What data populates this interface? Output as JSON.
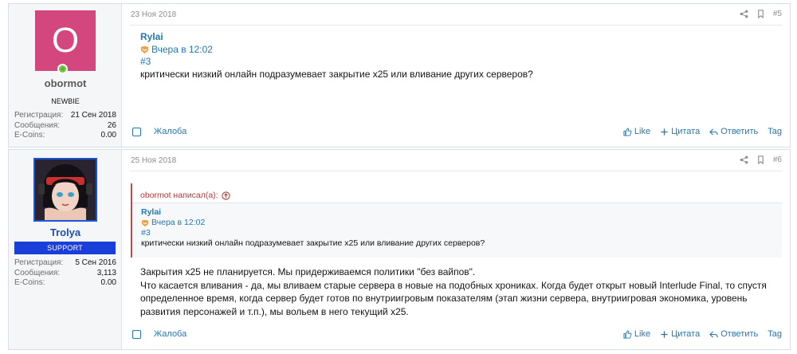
{
  "posts": [
    {
      "user": {
        "avatar_letter": "O",
        "name": "obormot",
        "title": "NEWBIE",
        "stats": [
          {
            "label": "Регистрация:",
            "value": "21 Сен 2018"
          },
          {
            "label": "Сообщения:",
            "value": "26"
          },
          {
            "label": "E-Coins:",
            "value": "0.00"
          }
        ]
      },
      "date": "23 Ноя 2018",
      "number": "#5",
      "content": {
        "author": "Rylai",
        "time": "Вчера в 12:02",
        "hash": "#3",
        "text": "критически низкий онлайн подразумевает закрытие х25 или вливание других серверов?"
      },
      "actions": {
        "report": "Жалоба",
        "like": "Like",
        "quote": "Цитата",
        "reply": "Ответить",
        "tag": "Tag"
      }
    },
    {
      "user": {
        "name": "Trolya",
        "title": "SUPPORT",
        "stats": [
          {
            "label": "Регистрация:",
            "value": "5 Сен 2016"
          },
          {
            "label": "Сообщения:",
            "value": "3,113"
          },
          {
            "label": "E-Coins:",
            "value": "0.00"
          }
        ]
      },
      "date": "25 Ноя 2018",
      "number": "#6",
      "quote": {
        "header": "obormot написал(а):",
        "author": "Rylai",
        "time": "Вчера в 12:02",
        "hash": "#3",
        "text": "критически низкий онлайн подразумевает закрытие х25 или вливание других серверов?"
      },
      "reply_lines": [
        "Закрытия х25 не планируется. Мы придерживаемся политики \"без вайпов\".",
        "Что касается вливания - да, мы вливаем старые сервера в новые на подобных хрониках. Когда будет открыт новый Interlude Final, то спустя",
        "определенное время, когда сервер будет готов по внутриигровым показателям (этап жизни сервера, внутриигровая экономика, уровень",
        "развития персонажей и т.п.), мы вольем в него текущий х25."
      ],
      "actions": {
        "report": "Жалоба",
        "like": "Like",
        "quote": "Цитата",
        "reply": "Ответить",
        "tag": "Tag"
      }
    }
  ],
  "colors": {
    "link": "#2577b1",
    "support_badge": "#1a3fd8",
    "avatar_bg": "#d3467e",
    "quote_border": "#d04343"
  }
}
